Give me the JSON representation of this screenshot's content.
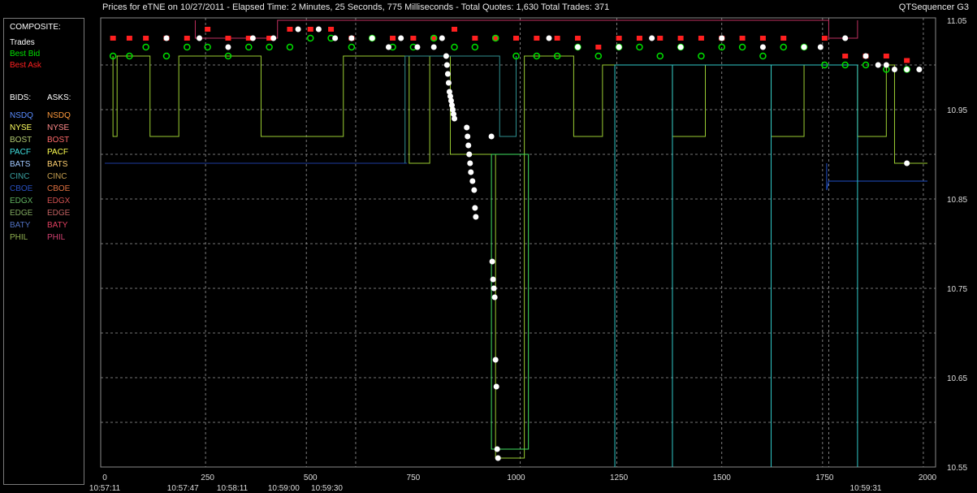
{
  "header": {
    "title": "Prices for  eTNE  on  10/27/2011  -  Elapsed Time: 2 Minutes, 25 Seconds, 775 Milliseconds  -  Total Quotes: 1,630  Total Trades: 371",
    "app_name": "QTSequencer G3"
  },
  "legend": {
    "composite_label": "COMPOSITE:",
    "composite": [
      {
        "label": "Trades",
        "color": "#ffffff"
      },
      {
        "label": "Best Bid",
        "color": "#00e000"
      },
      {
        "label": "Best Ask",
        "color": "#ff2020"
      }
    ],
    "bids_label": "BIDS:",
    "asks_label": "ASKS:",
    "exchanges": [
      {
        "bid": "NSDQ",
        "ask": "NSDQ",
        "bid_color": "#5a8cff",
        "ask_color": "#ff9a3c"
      },
      {
        "bid": "NYSE",
        "ask": "NYSE",
        "bid_color": "#ffff60",
        "ask_color": "#ff8a8a"
      },
      {
        "bid": "BOST",
        "ask": "BOST",
        "bid_color": "#b0c870",
        "ask_color": "#ff6a6a"
      },
      {
        "bid": "PACF",
        "ask": "PACF",
        "bid_color": "#40e0e0",
        "ask_color": "#ffff50"
      },
      {
        "bid": "BATS",
        "ask": "BATS",
        "bid_color": "#a0c8ff",
        "ask_color": "#ffd070"
      },
      {
        "bid": "CINC",
        "ask": "CINC",
        "bid_color": "#3aa0a0",
        "ask_color": "#c8a050"
      },
      {
        "bid": "CBOE",
        "ask": "CBOE",
        "bid_color": "#2850c0",
        "ask_color": "#e07040"
      },
      {
        "bid": "EDGX",
        "ask": "EDGX",
        "bid_color": "#60b060",
        "ask_color": "#d05050"
      },
      {
        "bid": "EDGE",
        "ask": "EDGE",
        "bid_color": "#80a860",
        "ask_color": "#c06060"
      },
      {
        "bid": "BATY",
        "ask": "BATY",
        "bid_color": "#5070c0",
        "ask_color": "#e04060"
      },
      {
        "bid": "PHIL",
        "ask": "PHIL",
        "bid_color": "#90b050",
        "ask_color": "#d04070"
      }
    ]
  },
  "chart_data": {
    "type": "scatter",
    "ylim": [
      10.55,
      11.05
    ],
    "xlim": [
      0,
      2000
    ],
    "y_ticks": [
      "11.05",
      "10.95",
      "10.85",
      "10.75",
      "10.65",
      "10.55"
    ],
    "y_tick_values": [
      11.05,
      10.95,
      10.85,
      10.75,
      10.65,
      10.55
    ],
    "y_grid_values": [
      11.0,
      10.95,
      10.9,
      10.85,
      10.8,
      10.75,
      10.7,
      10.65,
      10.6
    ],
    "x_ticks": [
      {
        "x": 0,
        "label": "0"
      },
      {
        "x": 250,
        "label": "250"
      },
      {
        "x": 500,
        "label": "500"
      },
      {
        "x": 750,
        "label": "750"
      },
      {
        "x": 1000,
        "label": "1000"
      },
      {
        "x": 1250,
        "label": "1250"
      },
      {
        "x": 1500,
        "label": "1500"
      },
      {
        "x": 1750,
        "label": "1750"
      },
      {
        "x": 2000,
        "label": "2000"
      }
    ],
    "time_labels": [
      {
        "x": 0,
        "label": "10:57:11"
      },
      {
        "x": 190,
        "label": "10:57:47"
      },
      {
        "x": 310,
        "label": "10:58:11"
      },
      {
        "x": 435,
        "label": "10:59:00"
      },
      {
        "x": 540,
        "label": "10:59:30"
      },
      {
        "x": 1850,
        "label": "10:59:31"
      }
    ],
    "vertical_grid_x": [
      245,
      490,
      610,
      1010,
      1245,
      1500,
      1745,
      1760,
      1990
    ],
    "series": [
      {
        "name": "Trades",
        "color": "#ffffff",
        "x": [
          150,
          230,
          300,
          360,
          410,
          470,
          520,
          560,
          600,
          650,
          690,
          720,
          760,
          800,
          820,
          830,
          832,
          834,
          836,
          838,
          840,
          842,
          844,
          846,
          848,
          850,
          880,
          882,
          884,
          886,
          888,
          890,
          894,
          898,
          900,
          902,
          940,
          942,
          944,
          946,
          948,
          950,
          952,
          954,
          956,
          1080,
          1150,
          1250,
          1330,
          1400,
          1500,
          1600,
          1700,
          1740,
          1800,
          1850,
          1880,
          1900,
          1920,
          1950,
          1980,
          1950
        ],
        "y": [
          11.03,
          11.03,
          11.02,
          11.03,
          11.03,
          11.04,
          11.04,
          11.03,
          11.03,
          11.03,
          11.02,
          11.03,
          11.02,
          11.02,
          11.03,
          11.01,
          11.0,
          10.99,
          10.98,
          10.97,
          10.965,
          10.96,
          10.955,
          10.95,
          10.945,
          10.94,
          10.93,
          10.92,
          10.91,
          10.9,
          10.89,
          10.88,
          10.87,
          10.86,
          10.84,
          10.83,
          10.92,
          10.78,
          10.76,
          10.75,
          10.74,
          10.67,
          10.64,
          10.57,
          10.56,
          11.03,
          11.02,
          11.02,
          11.03,
          11.02,
          11.03,
          11.02,
          11.02,
          11.02,
          11.03,
          11.01,
          11.0,
          11.0,
          10.995,
          10.995,
          10.995,
          10.89
        ]
      },
      {
        "name": "Best Bid",
        "color": "#00e000",
        "x": [
          20,
          60,
          100,
          150,
          200,
          250,
          300,
          350,
          400,
          450,
          500,
          550,
          600,
          650,
          700,
          750,
          800,
          850,
          900,
          950,
          1000,
          1050,
          1100,
          1150,
          1200,
          1250,
          1300,
          1350,
          1400,
          1450,
          1500,
          1550,
          1600,
          1650,
          1700,
          1750,
          1800,
          1850,
          1900,
          1950
        ],
        "y": [
          11.01,
          11.01,
          11.02,
          11.01,
          11.02,
          11.02,
          11.01,
          11.02,
          11.02,
          11.02,
          11.03,
          11.03,
          11.02,
          11.03,
          11.02,
          11.02,
          11.03,
          11.02,
          11.02,
          11.03,
          11.01,
          11.01,
          11.01,
          11.02,
          11.01,
          11.02,
          11.02,
          11.01,
          11.02,
          11.01,
          11.02,
          11.02,
          11.01,
          11.02,
          11.02,
          11.0,
          11.0,
          11.0,
          10.995,
          10.995
        ]
      },
      {
        "name": "Best Ask",
        "color": "#ff2020",
        "x": [
          20,
          60,
          100,
          150,
          200,
          250,
          300,
          350,
          400,
          450,
          500,
          550,
          600,
          650,
          700,
          750,
          800,
          850,
          900,
          950,
          1000,
          1050,
          1100,
          1150,
          1200,
          1250,
          1300,
          1350,
          1400,
          1450,
          1500,
          1550,
          1600,
          1650,
          1700,
          1750,
          1800,
          1850,
          1900,
          1950
        ],
        "y": [
          11.03,
          11.03,
          11.03,
          11.03,
          11.03,
          11.04,
          11.03,
          11.03,
          11.03,
          11.04,
          11.04,
          11.04,
          11.03,
          11.03,
          11.03,
          11.03,
          11.03,
          11.04,
          11.03,
          11.03,
          11.03,
          11.03,
          11.03,
          11.03,
          11.02,
          11.03,
          11.03,
          11.03,
          11.03,
          11.03,
          11.03,
          11.03,
          11.03,
          11.03,
          11.02,
          11.03,
          11.01,
          11.01,
          11.01,
          11.005
        ]
      }
    ],
    "quote_lines": [
      {
        "color": "#1e3ca0",
        "points": [
          [
            0,
            10.89
          ],
          [
            735,
            10.89
          ]
        ]
      },
      {
        "color": "#2050c8",
        "points": [
          [
            1755,
            10.89
          ],
          [
            1755,
            10.86
          ],
          [
            1760,
            10.87
          ],
          [
            2000,
            10.87
          ]
        ]
      },
      {
        "color": "#9acd32",
        "points": [
          [
            20,
            11.01
          ],
          [
            20,
            10.92
          ],
          [
            30,
            10.92
          ],
          [
            30,
            11.01
          ],
          [
            110,
            11.01
          ],
          [
            110,
            10.92
          ],
          [
            180,
            10.92
          ],
          [
            180,
            11.01
          ],
          [
            380,
            11.01
          ],
          [
            380,
            10.92
          ],
          [
            580,
            10.92
          ],
          [
            580,
            11.01
          ],
          [
            740,
            11.01
          ],
          [
            740,
            10.89
          ],
          [
            790,
            10.89
          ],
          [
            790,
            11.01
          ],
          [
            840,
            11.01
          ],
          [
            840,
            10.9
          ],
          [
            950,
            10.9
          ],
          [
            950,
            10.56
          ],
          [
            1020,
            10.56
          ],
          [
            1020,
            11.01
          ],
          [
            1140,
            11.01
          ],
          [
            1140,
            10.92
          ],
          [
            1210,
            10.92
          ],
          [
            1210,
            11.0
          ],
          [
            1380,
            11.0
          ],
          [
            1380,
            10.92
          ],
          [
            1460,
            10.92
          ],
          [
            1460,
            11.0
          ],
          [
            1620,
            11.0
          ],
          [
            1620,
            10.92
          ],
          [
            1700,
            10.92
          ],
          [
            1700,
            11.0
          ],
          [
            1830,
            11.0
          ],
          [
            1830,
            10.92
          ],
          [
            1900,
            10.92
          ],
          [
            1900,
            11.0
          ],
          [
            1920,
            11.0
          ],
          [
            1920,
            10.89
          ],
          [
            2000,
            10.89
          ]
        ]
      },
      {
        "color": "#30c8c8",
        "points": [
          [
            1240,
            11.0
          ],
          [
            1240,
            10.55
          ],
          [
            1240,
            11.0
          ],
          [
            1380,
            11.0
          ],
          [
            1380,
            10.55
          ],
          [
            1380,
            11.0
          ],
          [
            1620,
            11.0
          ],
          [
            1620,
            10.55
          ],
          [
            1620,
            11.0
          ],
          [
            1830,
            11.0
          ],
          [
            1830,
            10.55
          ]
        ]
      },
      {
        "color": "#40e060",
        "points": [
          [
            940,
            10.9
          ],
          [
            940,
            10.57
          ],
          [
            1030,
            10.57
          ],
          [
            1030,
            10.9
          ],
          [
            940,
            10.9
          ]
        ]
      },
      {
        "color": "#2f8f8f",
        "points": [
          [
            730,
            11.01
          ],
          [
            730,
            10.89
          ],
          [
            730,
            11.01
          ],
          [
            960,
            11.01
          ],
          [
            960,
            10.92
          ],
          [
            1000,
            10.92
          ],
          [
            1000,
            11.01
          ]
        ]
      },
      {
        "color": "#c03060",
        "points": [
          [
            220,
            11.05
          ],
          [
            220,
            11.03
          ],
          [
            420,
            11.03
          ],
          [
            420,
            11.05
          ],
          [
            1760,
            11.05
          ],
          [
            1760,
            11.03
          ],
          [
            1830,
            11.03
          ],
          [
            1830,
            11.05
          ]
        ]
      }
    ]
  }
}
